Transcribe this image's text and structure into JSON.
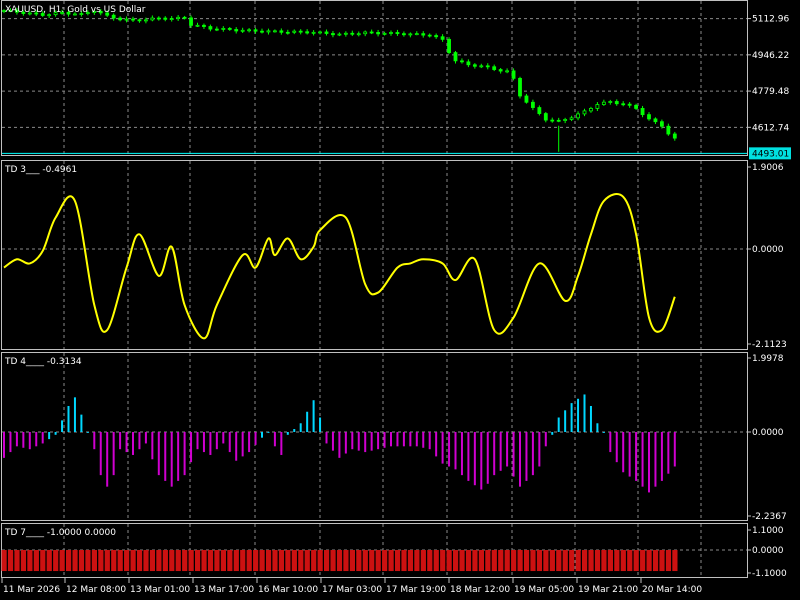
{
  "chart_data": [
    {
      "type": "line",
      "title": "XAUUSD, H1:  Gold vs US Dollar",
      "y_ticks": [
        "5112.96",
        "4946.22",
        "4779.48",
        "4612.74"
      ],
      "y_tick_values": [
        5112.96,
        4946.22,
        4779.48,
        4612.74
      ],
      "ylim": [
        4490,
        5180
      ],
      "current_price": "4493.01",
      "current_price_value": 4493.01,
      "series_color": "#00ff00",
      "price_line_color": "#00ffff",
      "x_index_range": [
        0,
        100
      ],
      "points": [
        [
          0,
          5150
        ],
        [
          3,
          5140
        ],
        [
          6,
          5130
        ],
        [
          9,
          5140
        ],
        [
          12,
          5132
        ],
        [
          14,
          5150
        ],
        [
          16,
          5125
        ],
        [
          18,
          5110
        ],
        [
          20,
          5105
        ],
        [
          22,
          5108
        ],
        [
          24,
          5115
        ],
        [
          26,
          5112
        ],
        [
          28,
          5118
        ],
        [
          29,
          5085
        ],
        [
          32,
          5068
        ],
        [
          36,
          5060
        ],
        [
          40,
          5055
        ],
        [
          44,
          5052
        ],
        [
          48,
          5050
        ],
        [
          52,
          5040
        ],
        [
          56,
          5048
        ],
        [
          60,
          5045
        ],
        [
          64,
          5040
        ],
        [
          66,
          5038
        ],
        [
          68,
          5015
        ],
        [
          69,
          4960
        ],
        [
          70,
          4920
        ],
        [
          72,
          4900
        ],
        [
          74,
          4895
        ],
        [
          76,
          4880
        ],
        [
          78,
          4870
        ],
        [
          79,
          4835
        ],
        [
          80,
          4760
        ],
        [
          82,
          4700
        ],
        [
          84,
          4650
        ],
        [
          86,
          4640
        ],
        [
          88,
          4660
        ],
        [
          90,
          4685
        ],
        [
          92,
          4720
        ],
        [
          94,
          4730
        ],
        [
          96,
          4720
        ],
        [
          98,
          4700
        ],
        [
          100,
          4650
        ],
        [
          102,
          4620
        ],
        [
          103,
          4585
        ],
        [
          104,
          4560
        ],
        [
          104.5,
          4548
        ]
      ]
    },
    {
      "type": "line",
      "title": "TD 3___ -0.4961",
      "y_ticks": [
        "1.9006",
        "0.0000",
        "-2.1123"
      ],
      "y_tick_values": [
        1.9006,
        0.0,
        -2.1123
      ],
      "ylim": [
        -2.1123,
        1.9006
      ],
      "series_color": "#ffff00",
      "x": [
        0,
        2,
        4,
        6,
        8,
        11,
        14,
        16,
        19,
        21,
        24,
        26,
        28,
        31,
        33,
        37,
        39,
        41,
        42,
        44,
        46,
        48,
        49,
        53,
        56,
        58,
        61,
        63,
        65,
        68,
        70,
        73,
        76,
        79,
        83,
        87,
        89,
        91,
        93,
        96,
        98,
        100,
        102,
        104
      ],
      "values": [
        -0.3,
        -0.1,
        -0.2,
        0.1,
        0.9,
        1.3,
        -1.2,
        -1.8,
        -0.3,
        0.5,
        -0.5,
        0.2,
        -1.2,
        -2.0,
        -1.2,
        0.0,
        -0.3,
        0.4,
        0.0,
        0.4,
        -0.1,
        0.2,
        0.6,
        0.9,
        -0.7,
        -0.9,
        -0.3,
        -0.2,
        -0.1,
        -0.2,
        -0.6,
        -0.1,
        -1.8,
        -1.5,
        -0.2,
        -1.1,
        -0.5,
        0.5,
        1.3,
        1.4,
        0.5,
        -1.5,
        -1.8,
        -1.0
      ]
    },
    {
      "type": "bar",
      "title": "TD 4____ -0.3134",
      "y_ticks": [
        "1.9978",
        "0.0000",
        "-2.2367"
      ],
      "y_tick_values": [
        1.9978,
        0.0,
        -2.2367
      ],
      "ylim": [
        -2.2367,
        1.9978
      ],
      "positive_color": "#00d8ff",
      "negative_color": "#d000d0",
      "bar_count": 105,
      "control_x": [
        0,
        2,
        4,
        6,
        8,
        10,
        11,
        13,
        14,
        15,
        16,
        17,
        18,
        20,
        22,
        24,
        26,
        28,
        30,
        32,
        34,
        36,
        38,
        40,
        41,
        42,
        43,
        44,
        46,
        47,
        48,
        49,
        50,
        52,
        54,
        56,
        58,
        60,
        62,
        64,
        66,
        68,
        70,
        72,
        74,
        75,
        76,
        78,
        80,
        82,
        83,
        84,
        85,
        86,
        88,
        90,
        91,
        92,
        93,
        94,
        96,
        98,
        100,
        102,
        104
      ],
      "control_values": [
        -0.6,
        -0.2,
        -0.3,
        -0.1,
        0.2,
        1.2,
        1.5,
        0.3,
        -0.3,
        -1.2,
        -1.6,
        -1.2,
        -0.3,
        -0.5,
        -0.1,
        -1.2,
        -1.6,
        -1.2,
        -0.3,
        -0.5,
        -0.1,
        -0.7,
        -0.4,
        0.1,
        0.3,
        -0.2,
        -0.5,
        0.2,
        0.6,
        1.0,
        1.4,
        0.8,
        -0.1,
        -0.6,
        -0.3,
        -0.4,
        -0.3,
        -0.2,
        -0.2,
        -0.2,
        -0.3,
        -0.8,
        -1.0,
        -1.4,
        -1.7,
        -1.5,
        -1.2,
        -0.9,
        -1.6,
        -1.2,
        -0.9,
        -0.2,
        0.2,
        0.8,
        1.3,
        1.6,
        1.2,
        0.6,
        0.3,
        -0.4,
        -1.1,
        -1.4,
        -1.8,
        -1.4,
        -0.9
      ]
    },
    {
      "type": "bar",
      "title": "TD 7____ -1.0000  0.0000",
      "y_ticks": [
        "1.1000",
        "0.0000",
        "-1.1000"
      ],
      "y_tick_values": [
        1.1,
        0.0,
        -1.1
      ],
      "ylim": [
        -1.1,
        1.1
      ],
      "bar_color": "#cc1111",
      "bar_count": 105,
      "value": -1.0
    }
  ],
  "x_axis": {
    "labels": [
      "11 Mar 2026",
      "12 Mar 08:00",
      "13 Mar 01:00",
      "13 Mar 17:00",
      "16 Mar 10:00",
      "17 Mar 03:00",
      "17 Mar 19:00",
      "18 Mar 12:00",
      "19 Mar 05:00",
      "19 Mar 21:00",
      "20 Mar 14:00"
    ]
  },
  "colors": {
    "background": "#000000",
    "grid": "#8a8a8a",
    "panel_border": "#c0c0c0",
    "text": "#ffffff",
    "price_tag_bg": "#00e0e0"
  },
  "grid": true
}
